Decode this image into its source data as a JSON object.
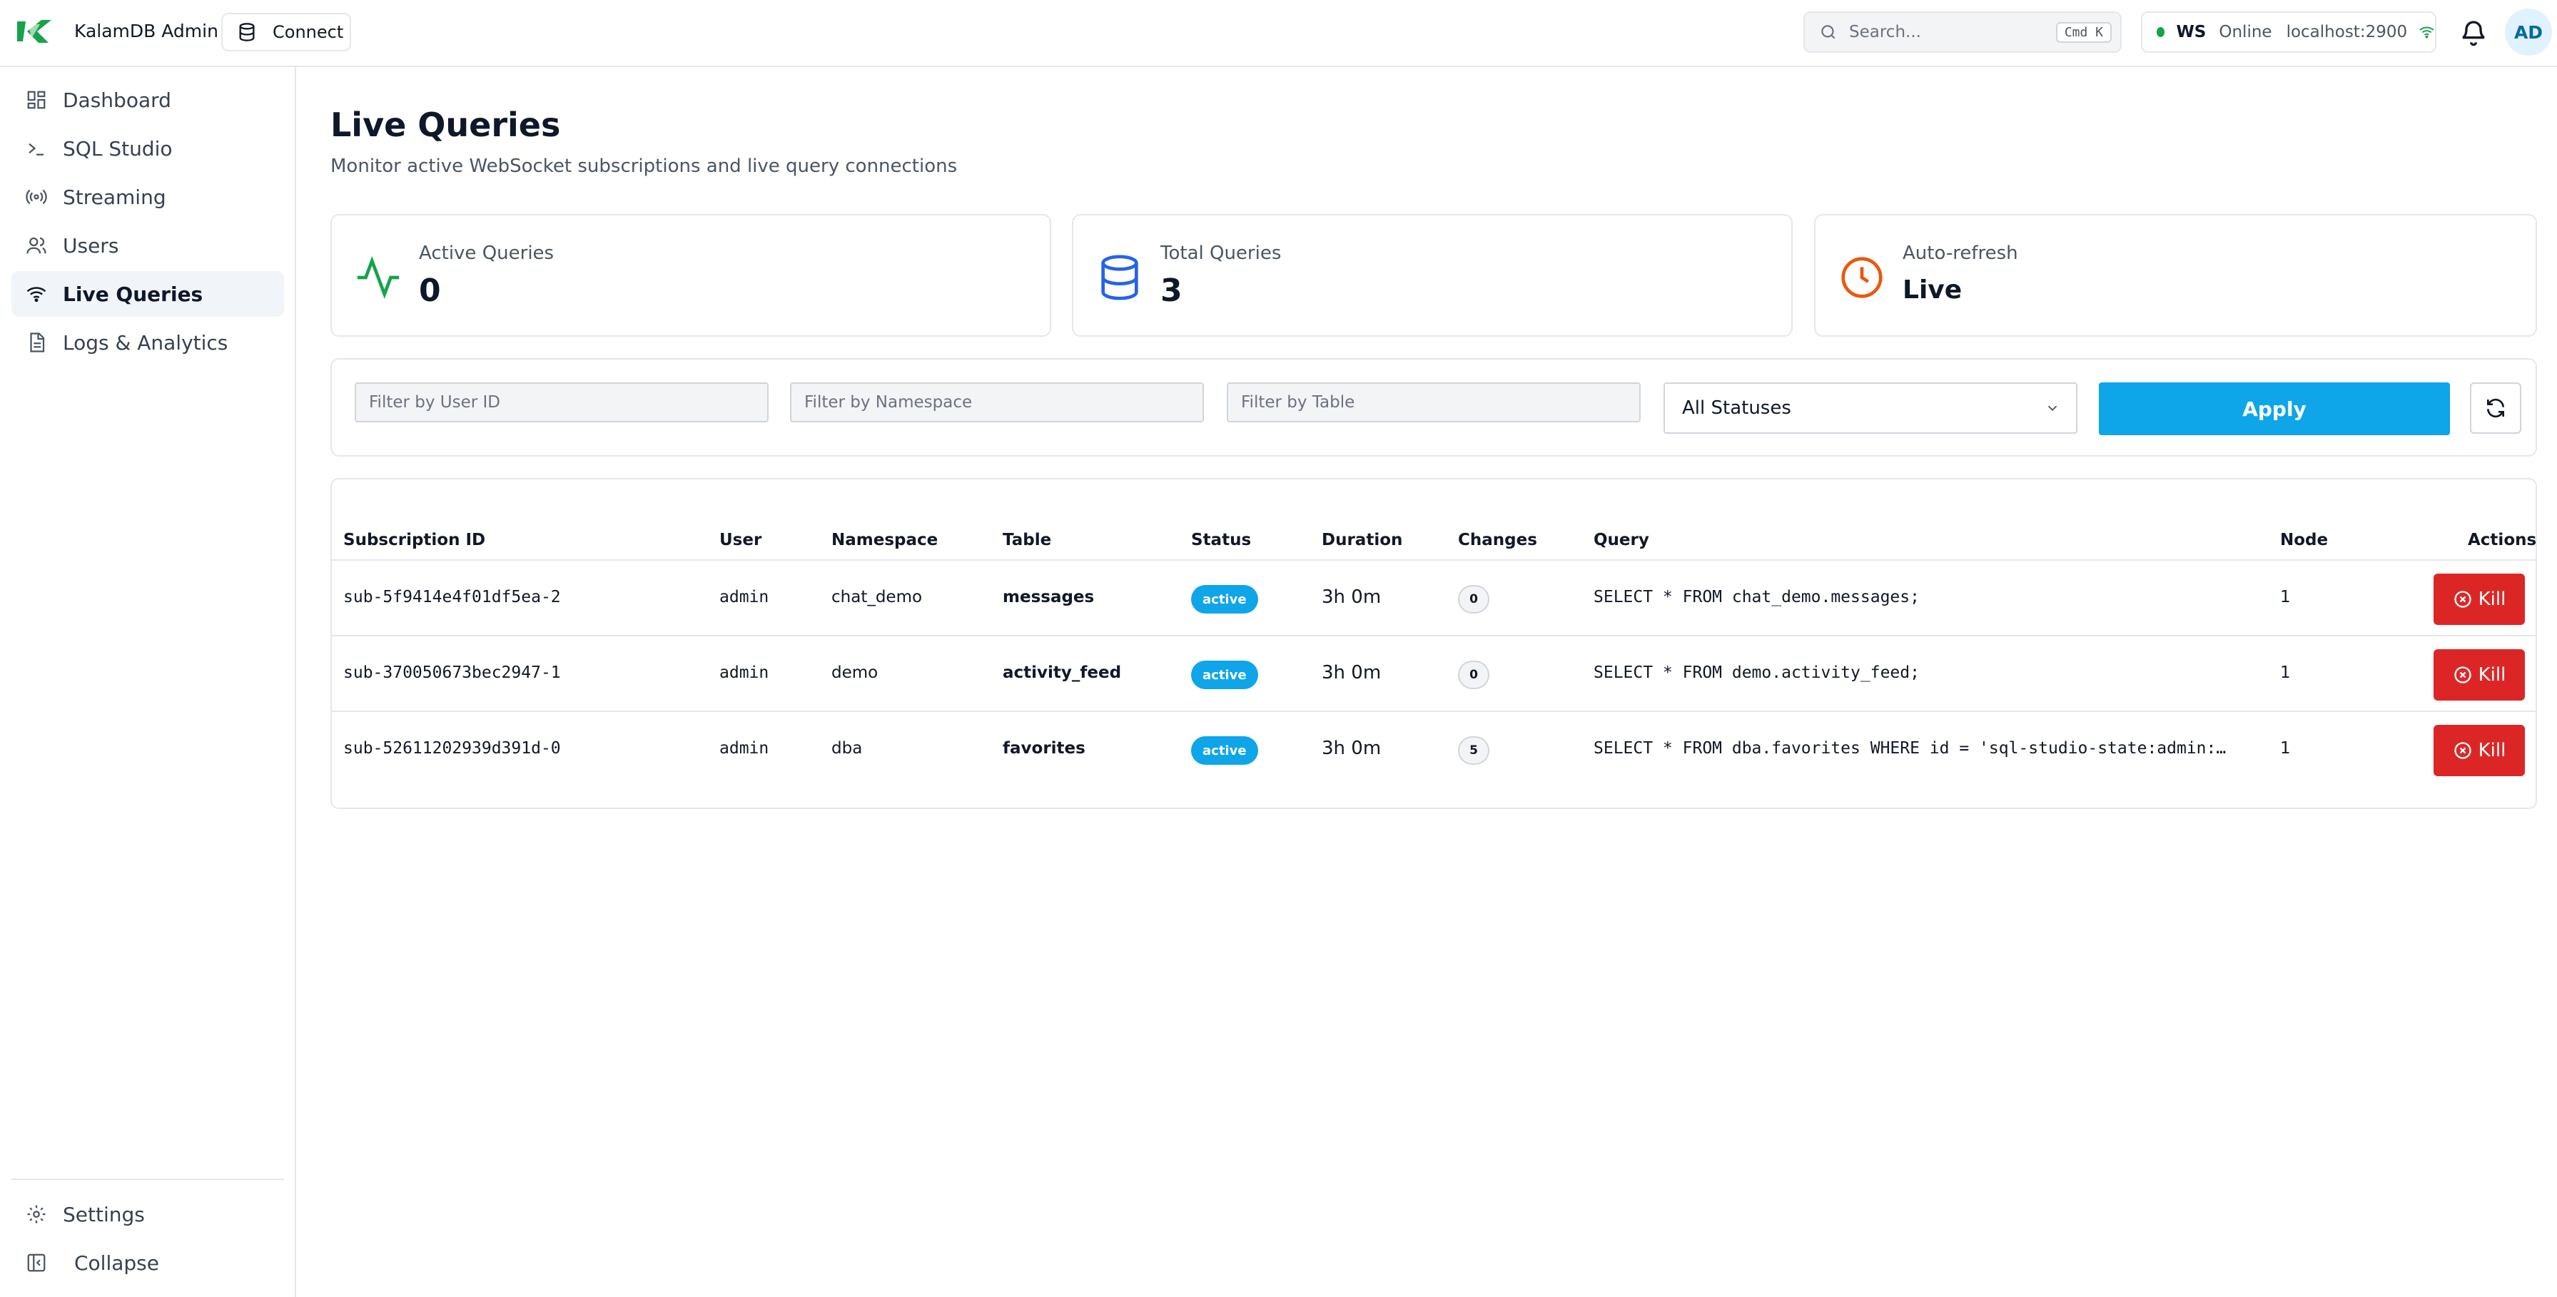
{
  "app": {
    "title": "KalamDB Admin",
    "connect_label": "Connect"
  },
  "search": {
    "placeholder": "Search...",
    "shortcut": "Cmd K"
  },
  "connection": {
    "label": "WS",
    "status": "Online",
    "host": "localhost:2900",
    "status_color": "#16a34a"
  },
  "user": {
    "initials": "AD"
  },
  "sidebar": {
    "items": [
      {
        "label": "Dashboard",
        "icon": "dashboard-icon"
      },
      {
        "label": "SQL Studio",
        "icon": "terminal-icon"
      },
      {
        "label": "Streaming",
        "icon": "radio-icon"
      },
      {
        "label": "Users",
        "icon": "users-icon"
      },
      {
        "label": "Live Queries",
        "icon": "wifi-icon",
        "active": true
      },
      {
        "label": "Logs & Analytics",
        "icon": "file-icon"
      }
    ],
    "settings_label": "Settings",
    "collapse_label": "Collapse"
  },
  "page": {
    "title": "Live Queries",
    "subtitle": "Monitor active WebSocket subscriptions and live query connections"
  },
  "stats": [
    {
      "label": "Active Queries",
      "value": "0",
      "icon": "activity-icon",
      "color": "#16a34a"
    },
    {
      "label": "Total Queries",
      "value": "3",
      "icon": "database-icon",
      "color": "#2563eb"
    },
    {
      "label": "Auto-refresh",
      "value": "Live",
      "icon": "clock-icon",
      "color": "#ea580c"
    }
  ],
  "filters": {
    "user_placeholder": "Filter by User ID",
    "namespace_placeholder": "Filter by Namespace",
    "table_placeholder": "Filter by Table",
    "status_selected": "All Statuses",
    "apply_label": "Apply"
  },
  "table": {
    "headers": [
      "Subscription ID",
      "User",
      "Namespace",
      "Table",
      "Status",
      "Duration",
      "Changes",
      "Query",
      "Node",
      "Actions"
    ],
    "kill_label": "Kill",
    "rows": [
      {
        "id": "sub-5f9414e4f01df5ea-2",
        "user": "admin",
        "namespace": "chat_demo",
        "table": "messages",
        "status": "active",
        "duration": "3h 0m",
        "changes": "0",
        "query": "SELECT * FROM chat_demo.messages;",
        "node": "1"
      },
      {
        "id": "sub-370050673bec2947-1",
        "user": "admin",
        "namespace": "demo",
        "table": "activity_feed",
        "status": "active",
        "duration": "3h 0m",
        "changes": "0",
        "query": "SELECT * FROM demo.activity_feed;",
        "node": "1"
      },
      {
        "id": "sub-52611202939d391d-0",
        "user": "admin",
        "namespace": "dba",
        "table": "favorites",
        "status": "active",
        "duration": "3h 0m",
        "changes": "5",
        "query": "SELECT * FROM dba.favorites WHERE id = 'sql-studio-state:admin:…",
        "node": "1"
      }
    ]
  }
}
